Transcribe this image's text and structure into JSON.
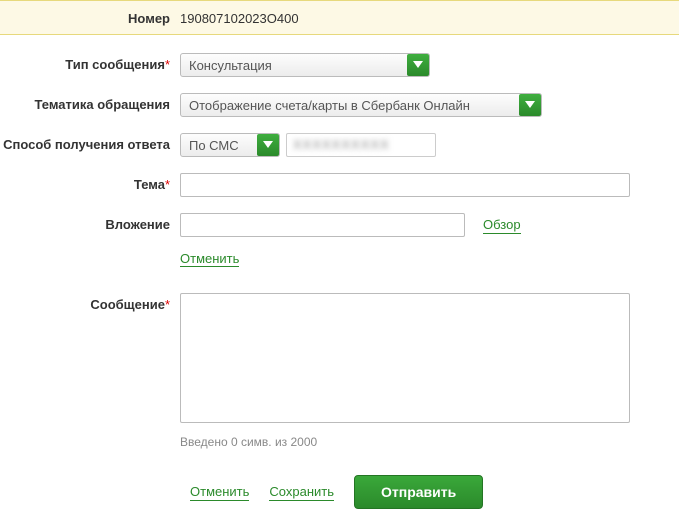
{
  "nomer": {
    "label": "Номер",
    "value": "190807102023О400"
  },
  "type": {
    "label": "Тип сообщения",
    "value": "Консультация"
  },
  "topic": {
    "label": "Тематика обращения",
    "value": "Отображение счета/карты в Сбербанк Онлайн"
  },
  "answer_method": {
    "label": "Способ получения ответа",
    "value": "По СМС",
    "masked": "XXXXXXXXXX"
  },
  "subject": {
    "label": "Тема"
  },
  "attachment": {
    "label": "Вложение",
    "browse": "Обзор",
    "cancel": "Отменить"
  },
  "message": {
    "label": "Сообщение",
    "counter": "Введено 0 симв. из 2000"
  },
  "actions": {
    "cancel": "Отменить",
    "save": "Сохранить",
    "send": "Отправить"
  }
}
